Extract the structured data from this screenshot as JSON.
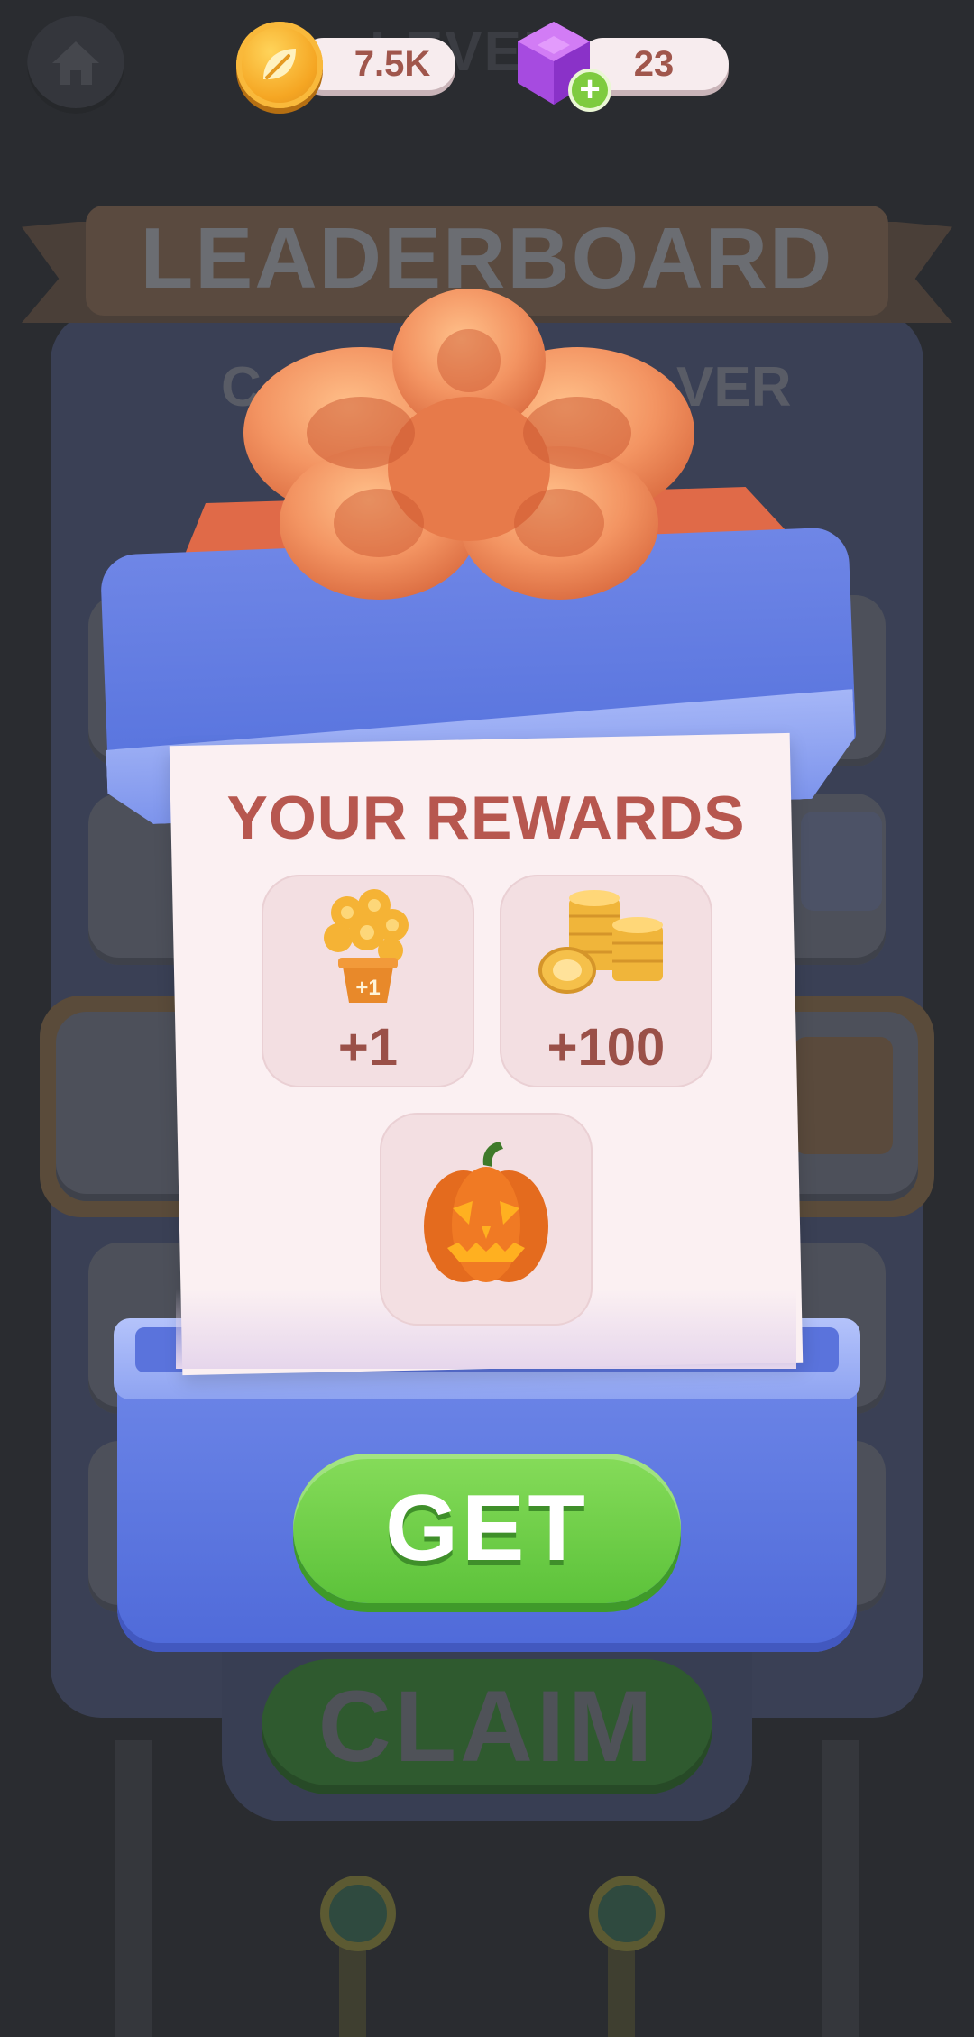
{
  "hud": {
    "coins": "7.5K",
    "gems": "23",
    "level_label": "LEVEL"
  },
  "board": {
    "title": "LEADERBOARD",
    "subtitle_left": "C",
    "subtitle_right": "VER",
    "claim_label": "CLAIM"
  },
  "rewards": {
    "title": "YOUR REWARDS",
    "items": [
      {
        "name": "golden-flower-pot",
        "badge": "+1",
        "amount": "+1"
      },
      {
        "name": "coin-stack",
        "amount": "+100"
      },
      {
        "name": "jack-o-lantern",
        "amount": ""
      }
    ]
  },
  "get_button": {
    "label": "GET"
  },
  "colors": {
    "background": "#2a2c30",
    "box_blue": "#5874de",
    "ribbon": "#f08a5d",
    "card": "#fbf0f2",
    "title_red": "#b7574f",
    "button_green": "#6fd04a"
  },
  "icons": [
    "home-icon",
    "leaf-coin-icon",
    "gem-icon",
    "plus-icon",
    "bow-icon"
  ]
}
